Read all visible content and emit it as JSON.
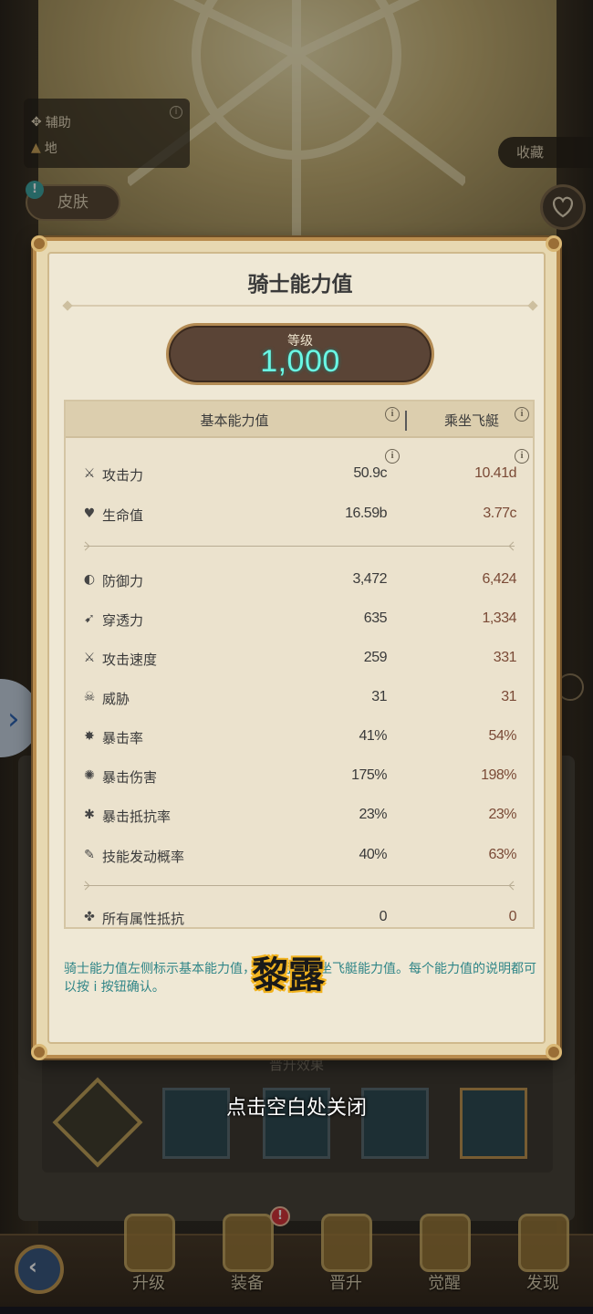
{
  "background": {
    "info_chip": {
      "role_label": "辅助",
      "element_label": "地"
    },
    "skin_button": "皮肤",
    "collect_button": "收藏",
    "promote_section_title": "晋升效果",
    "close_hint": "点击空白处关闭",
    "nav": [
      {
        "label": "升级",
        "icon": "level-up-icon"
      },
      {
        "label": "装备",
        "icon": "equipment-shield-icon"
      },
      {
        "label": "晋升",
        "icon": "promote-star-icon"
      },
      {
        "label": "觉醒",
        "icon": "awaken-burst-icon"
      },
      {
        "label": "发现",
        "icon": "discover-diamond-icon"
      }
    ],
    "nav_badge": "!"
  },
  "modal": {
    "title": "骑士能力值",
    "level_label": "等级",
    "level_value": "1,000",
    "header_basic": "基本能力值",
    "header_ride": "乘坐飞艇",
    "group1": [
      {
        "name": "攻击力",
        "icon": "sword-icon",
        "base": "50.9c",
        "ride": "10.41d"
      },
      {
        "name": "生命值",
        "icon": "heart-icon",
        "base": "16.59b",
        "ride": "3.77c"
      }
    ],
    "group2": [
      {
        "name": "防御力",
        "icon": "shield-icon",
        "base": "3,472",
        "ride": "6,424"
      },
      {
        "name": "穿透力",
        "icon": "pierce-icon",
        "base": "635",
        "ride": "1,334"
      },
      {
        "name": "攻击速度",
        "icon": "attack-speed-icon",
        "base": "259",
        "ride": "331"
      },
      {
        "name": "威胁",
        "icon": "threat-icon",
        "base": "31",
        "ride": "31"
      },
      {
        "name": "暴击率",
        "icon": "crit-rate-icon",
        "base": "41%",
        "ride": "54%"
      },
      {
        "name": "暴击伤害",
        "icon": "crit-damage-icon",
        "base": "175%",
        "ride": "198%"
      },
      {
        "name": "暴击抵抗率",
        "icon": "crit-resist-icon",
        "base": "23%",
        "ride": "23%"
      },
      {
        "name": "技能发动概率",
        "icon": "skill-proc-icon",
        "base": "40%",
        "ride": "63%"
      }
    ],
    "group3": [
      {
        "name": "所有属性抵抗",
        "icon": "element-resist-icon",
        "base": "0",
        "ride": "0"
      }
    ],
    "description": "骑士能力值左侧标示基本能力值，右侧标示乘坐飞艇能力值。每个能力值的说明都可以按 i 按钮确认。",
    "name_tag": "黎露"
  },
  "colors": {
    "level_value": "#6af7e4",
    "description": "#2f8587",
    "ride_values": "#7a4a36",
    "modal_border": "#b98c4e"
  }
}
